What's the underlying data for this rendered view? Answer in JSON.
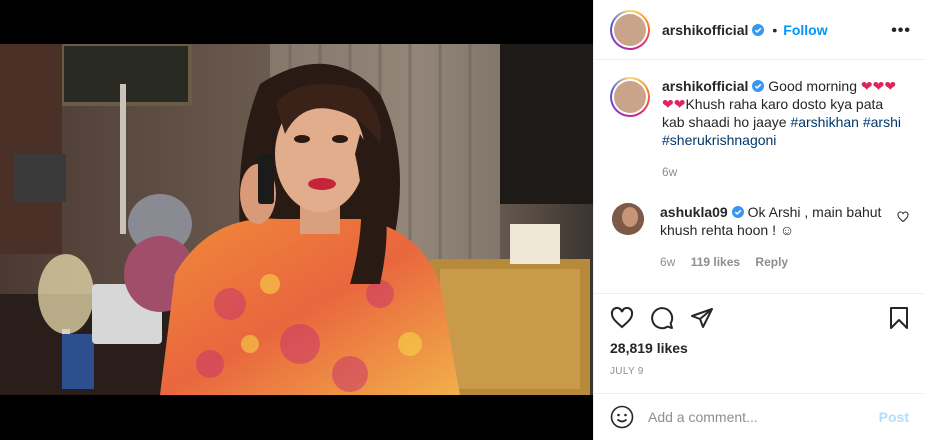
{
  "post": {
    "username": "arshikofficial",
    "dot": "•",
    "follow_label": "Follow",
    "more_label": "•••"
  },
  "caption": {
    "username": "arshikofficial",
    "text_1": " Good morning ",
    "hearts_1": "❤❤❤",
    "hearts_2": "❤❤",
    "text_2": "Khush raha karo dosto kya pata kab shaadi ho jaaye ",
    "hashtag_1": "#arshikhan",
    "hashtag_2": "#arshi",
    "hashtag_3": "#sherukrishnagoni",
    "age": "6w"
  },
  "reply": {
    "username": "ashukla09",
    "text": " Ok Arshi , main bahut khush rehta hoon ! ☺",
    "age": "6w",
    "likes": "119 likes",
    "reply_label": "Reply"
  },
  "stats": {
    "likes": "28,819 likes",
    "date": "JULY 9"
  },
  "composer": {
    "placeholder": "Add a comment...",
    "post_label": "Post"
  },
  "icons": {
    "verified": "verified-badge-icon",
    "like": "heart-icon",
    "comment": "comment-bubble-icon",
    "share": "paper-plane-icon",
    "save": "bookmark-icon",
    "emoji": "smiley-icon"
  },
  "colors": {
    "link": "#0095f6",
    "hashtag": "#00376b",
    "muted": "#8e8e8e",
    "post_disabled": "#b2dffc"
  }
}
